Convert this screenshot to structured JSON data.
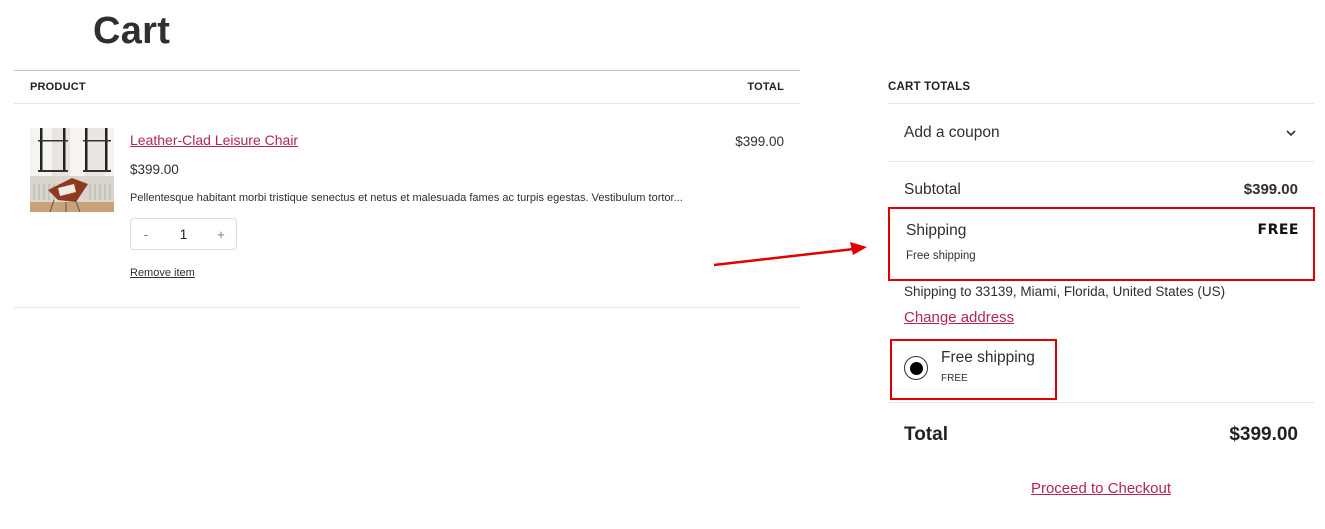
{
  "page": {
    "title": "Cart"
  },
  "cart": {
    "headers": {
      "product": "PRODUCT",
      "total": "TOTAL"
    },
    "items": [
      {
        "name": "Leather-Clad Leisure Chair",
        "price": "$399.00",
        "description": "Pellentesque habitant morbi tristique senectus et netus et malesuada fames ac turpis egestas. Vestibulum tortor...",
        "quantity": "1",
        "decrement_label": "-",
        "increment_label": "+",
        "remove_label": "Remove item",
        "line_total": "$399.00",
        "image_icon": "product-image-chair"
      }
    ]
  },
  "totals": {
    "heading": "CART TOTALS",
    "coupon_label": "Add a coupon",
    "subtotal_label": "Subtotal",
    "subtotal_value": "$399.00",
    "shipping_label": "Shipping",
    "shipping_value": "FREE",
    "shipping_method": "Free shipping",
    "shipping_destination": "Shipping to 33139, Miami, Florida, United States (US)",
    "change_address_label": "Change address",
    "rate": {
      "name": "Free shipping",
      "price": "FREE",
      "selected": true
    },
    "total_label": "Total",
    "total_value": "$399.00",
    "checkout_label": "Proceed to Checkout"
  },
  "colors": {
    "accent": "#b3245c",
    "annotation": "#e00000",
    "text": "#2f2f2f"
  }
}
